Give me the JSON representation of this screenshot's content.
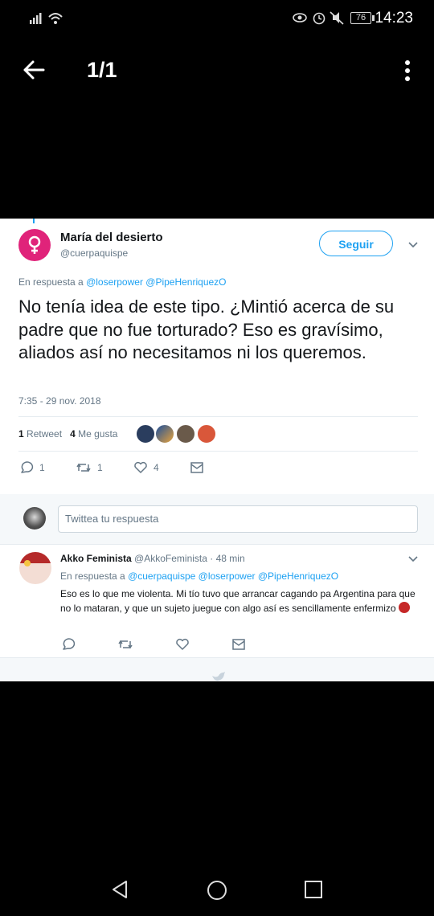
{
  "status_bar": {
    "battery": "76",
    "time": "14:23"
  },
  "header": {
    "counter": "1/1"
  },
  "tweet": {
    "author_name": "María del desierto",
    "author_handle": "@cuerpaquispe",
    "follow_label": "Seguir",
    "reply_prefix": "En respuesta a",
    "reply_to": "@loserpower @PipeHenriquezO",
    "text": "No tenía idea de este tipo. ¿Mintió acerca de su padre que no fue torturado? Eso es gravísimo, aliados así no necesitamos ni los queremos.",
    "timestamp": "7:35 - 29 nov. 2018",
    "retweets_count": "1",
    "retweets_label": "Retweet",
    "likes_count": "4",
    "likes_label": "Me gusta",
    "actions": {
      "reply_count": "1",
      "retweet_count": "1",
      "like_count": "4"
    }
  },
  "compose": {
    "placeholder": "Twittea tu respuesta"
  },
  "reply": {
    "author_name": "Akko Feminista",
    "author_handle": "@AkkoFeminista",
    "time": "· 48 min",
    "reply_prefix": "En respuesta a",
    "reply_to": "@cuerpaquispe @loserpower @PipeHenriquezO",
    "text": "Eso es lo que me violenta. Mi tío tuvo que arrancar cagando pa Argentina para que no lo mataran, y que un sujeto juegue con algo así es sencillamente enfermizo"
  },
  "colors": {
    "accent": "#1da1f2",
    "avatar_magenta": "#e0237a",
    "background": "#000000"
  }
}
